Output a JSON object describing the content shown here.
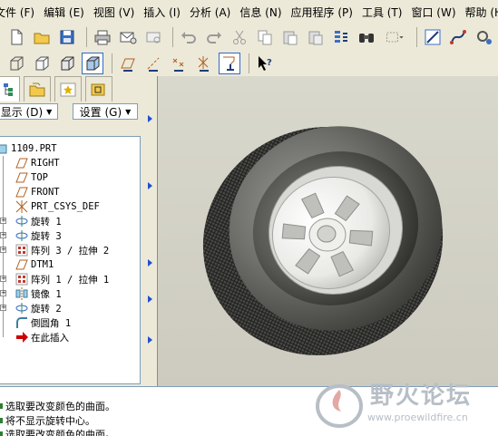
{
  "menu": [
    {
      "label": "文件 (F)"
    },
    {
      "label": "编辑 (E)"
    },
    {
      "label": "视图 (V)"
    },
    {
      "label": "插入 (I)"
    },
    {
      "label": "分析 (A)"
    },
    {
      "label": "信息 (N)"
    },
    {
      "label": "应用程序 (P)"
    },
    {
      "label": "工具 (T)"
    },
    {
      "label": "窗口 (W)"
    },
    {
      "label": "帮助 (H)"
    }
  ],
  "panel": {
    "display_label": "显示 (D)",
    "settings_label": "设置 (G)"
  },
  "tree": {
    "root": "1109.PRT",
    "items": [
      {
        "label": "RIGHT",
        "icon": "datum-plane-icon",
        "expandable": false
      },
      {
        "label": "TOP",
        "icon": "datum-plane-icon",
        "expandable": false
      },
      {
        "label": "FRONT",
        "icon": "datum-plane-icon",
        "expandable": false
      },
      {
        "label": "PRT_CSYS_DEF",
        "icon": "coordinate-system-icon",
        "expandable": false
      },
      {
        "label": "旋转 1",
        "icon": "revolve-icon",
        "expandable": true
      },
      {
        "label": "旋转 3",
        "icon": "revolve-icon",
        "expandable": true
      },
      {
        "label": "阵列 3 / 拉伸 2",
        "icon": "pattern-icon",
        "expandable": true
      },
      {
        "label": "DTM1",
        "icon": "datum-plane-icon",
        "expandable": false
      },
      {
        "label": "阵列 1 / 拉伸 1",
        "icon": "pattern-icon",
        "expandable": true
      },
      {
        "label": "镜像 1",
        "icon": "mirror-icon",
        "expandable": true
      },
      {
        "label": "旋转 2",
        "icon": "revolve-icon",
        "expandable": true
      },
      {
        "label": "倒圆角 1",
        "icon": "round-icon",
        "expandable": false
      },
      {
        "label": "在此插入",
        "icon": "insert-here-arrow-icon",
        "expandable": false
      }
    ]
  },
  "messages": [
    "选取要改变颜色的曲面。",
    "将不显示旋转中心。",
    "选取要改变颜色的曲面。"
  ],
  "watermark": {
    "title": "野火论坛",
    "url": "www.proewildfire.cn"
  },
  "colors": {
    "insert_arrow": "#cc0000",
    "datum_plane": "#b06020",
    "coordinate_system": "#b06020",
    "pattern": "#c0392b",
    "tire": "#4a4a47",
    "rim": "#f3f3f0"
  }
}
